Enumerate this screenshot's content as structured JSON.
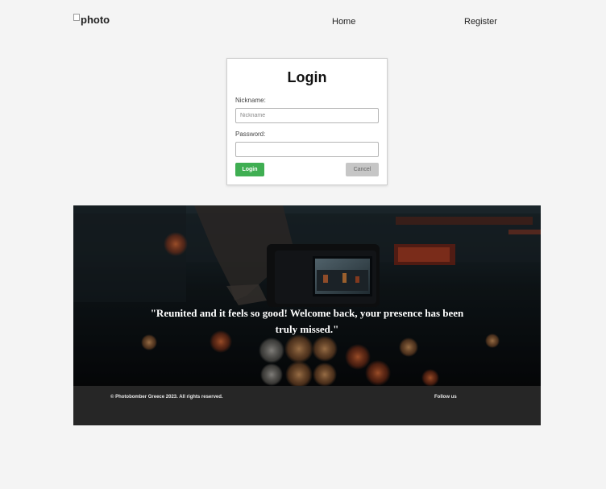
{
  "header": {
    "logo_alt": "photo",
    "nav": {
      "home": "Home",
      "register": "Register"
    }
  },
  "login": {
    "title": "Login",
    "nickname_label": "Nickname:",
    "nickname_placeholder": "Nickname",
    "nickname_value": "",
    "password_label": "Password:",
    "password_value": "",
    "login_button": "Login",
    "cancel_button": "Cancel"
  },
  "hero": {
    "quote": "\"Reunited and it feels so good! Welcome back, your presence has been truly missed.\""
  },
  "footer": {
    "copyright": "© Photobomber Greece 2023. All rights reserved.",
    "follow": "Follow us"
  },
  "colors": {
    "page_background": "#f4f4f4",
    "login_button": "#3fae52",
    "cancel_button": "#c6c6c6",
    "footer_background": "#262626"
  }
}
